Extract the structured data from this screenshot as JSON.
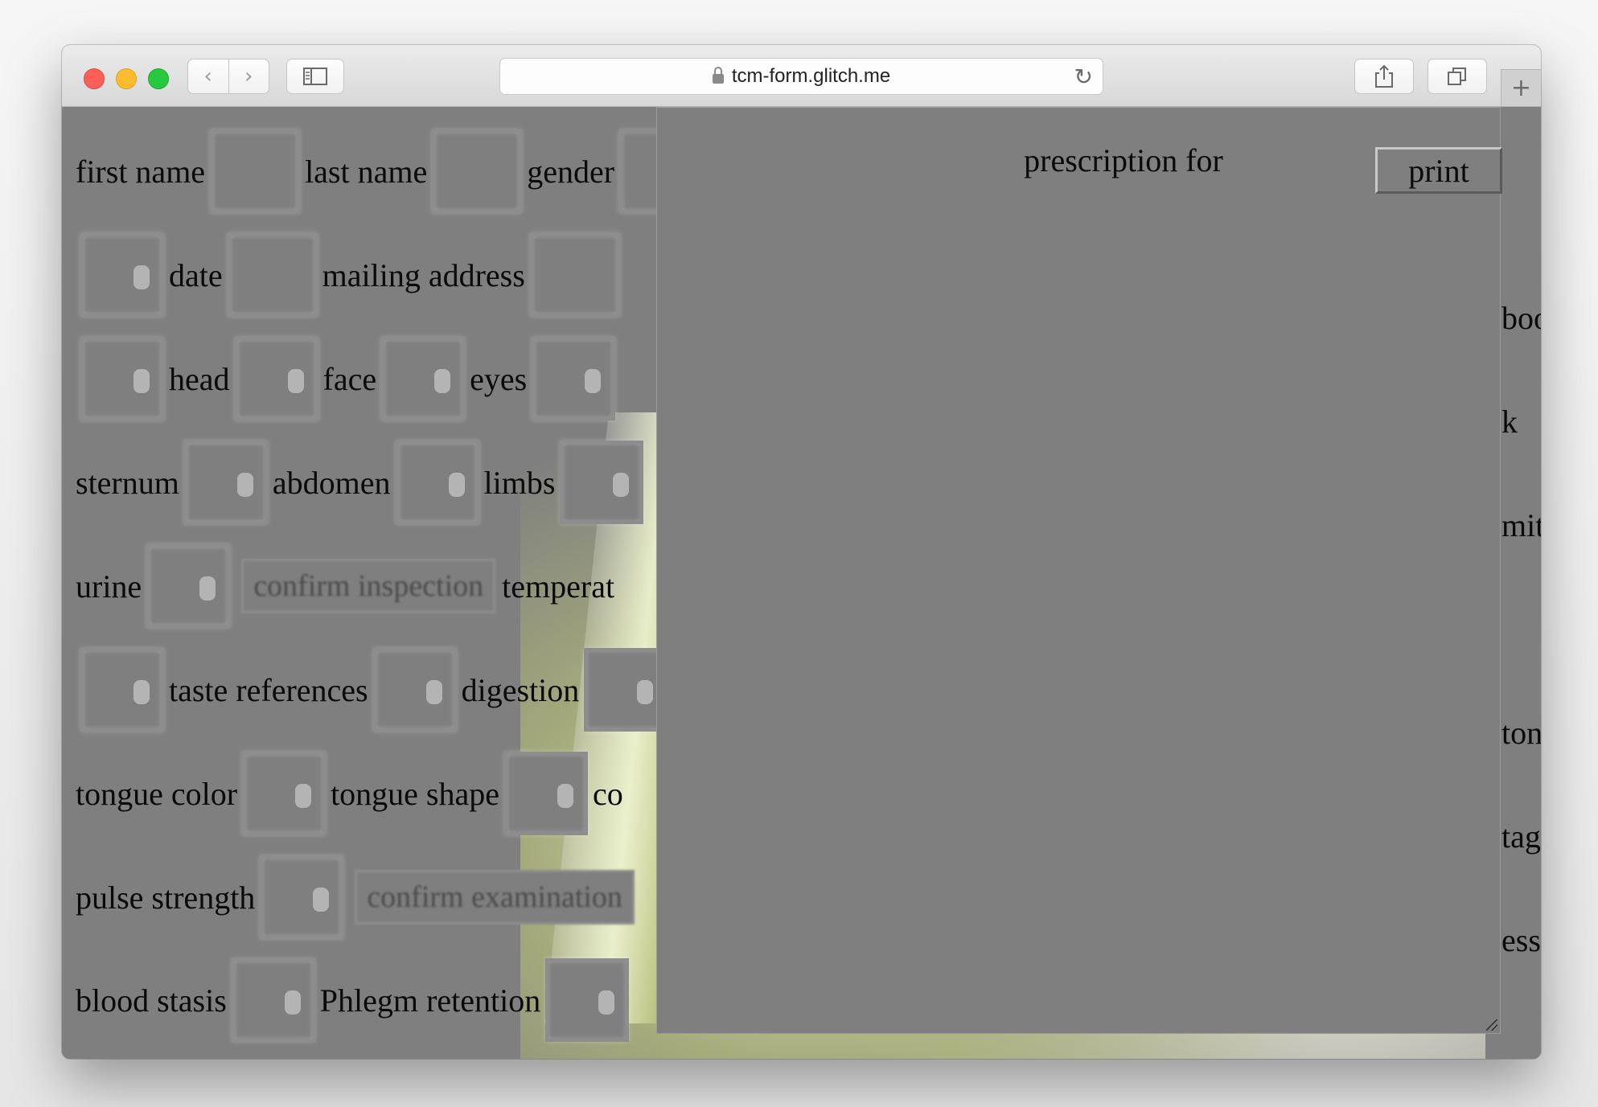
{
  "browser": {
    "url": "tcm-form.glitch.me",
    "back_icon": "chevron-left-icon",
    "forward_icon": "chevron-right-icon",
    "sidebar_icon": "sidebar-icon",
    "share_icon": "share-icon",
    "tabs_icon": "tabs-icon",
    "new_tab_label": "+",
    "reload_icon": "reload-icon"
  },
  "form": {
    "labels": {
      "first_name": "first name",
      "last_name": "last name",
      "gender": "gender",
      "date": "date",
      "mailing_address": "mailing address",
      "head": "head",
      "face": "face",
      "eyes": "eyes",
      "sternum": "sternum",
      "abdomen": "abdomen",
      "limbs": "limbs",
      "urine": "urine",
      "temperature": "temperat",
      "taste_references": "taste references",
      "digestion": "digestion",
      "tongue_color": "tongue color",
      "tongue_shape": "tongue shape",
      "co": "co",
      "pulse_strength": "pulse strength",
      "blood_stasis": "blood stasis",
      "phlegm_retention": "Phlegm retention"
    },
    "buttons": {
      "confirm_inspection": "confirm inspection",
      "confirm_examination": "confirm examination"
    },
    "right_edge": [
      "boo",
      "k",
      "mit",
      "ton",
      "tag",
      "ess"
    ]
  },
  "panel": {
    "title": "prescription for",
    "print_label": "print"
  }
}
